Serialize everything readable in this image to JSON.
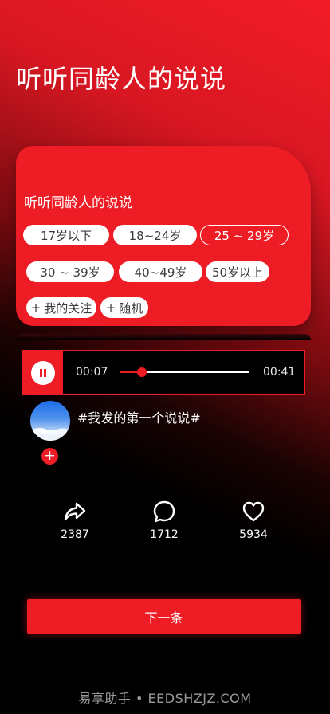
{
  "page": {
    "title": "听听同龄人的说说"
  },
  "filter": {
    "title": "听听同龄人的说说",
    "chips": [
      {
        "label": "17岁以下",
        "selected": false
      },
      {
        "label": "18~24岁",
        "selected": false
      },
      {
        "label": "25 ~ 29岁",
        "selected": true
      },
      {
        "label": "30 ~ 39岁",
        "selected": false
      },
      {
        "label": "40~49岁",
        "selected": false
      },
      {
        "label": "50岁以上",
        "selected": false
      },
      {
        "label": "我的关注",
        "selected": false
      },
      {
        "label": "随机",
        "selected": false
      }
    ]
  },
  "player": {
    "current_time": "00:07",
    "total_time": "00:41",
    "progress": 0.17,
    "state_icon": "pause-icon"
  },
  "post": {
    "text": "#我发的第一个说说#",
    "avatar_icon": "avatar",
    "follow_icon": "plus-icon"
  },
  "actions": {
    "share_count": "2387",
    "comment_count": "1712",
    "like_count": "5934"
  },
  "next_button": {
    "label": "下一条"
  },
  "watermark": {
    "text": "易享助手 • EEDSHZJZ.COM"
  },
  "colors": {
    "accent": "#ee1c25",
    "background": "#000000",
    "chip_bg": "#ffffff"
  }
}
